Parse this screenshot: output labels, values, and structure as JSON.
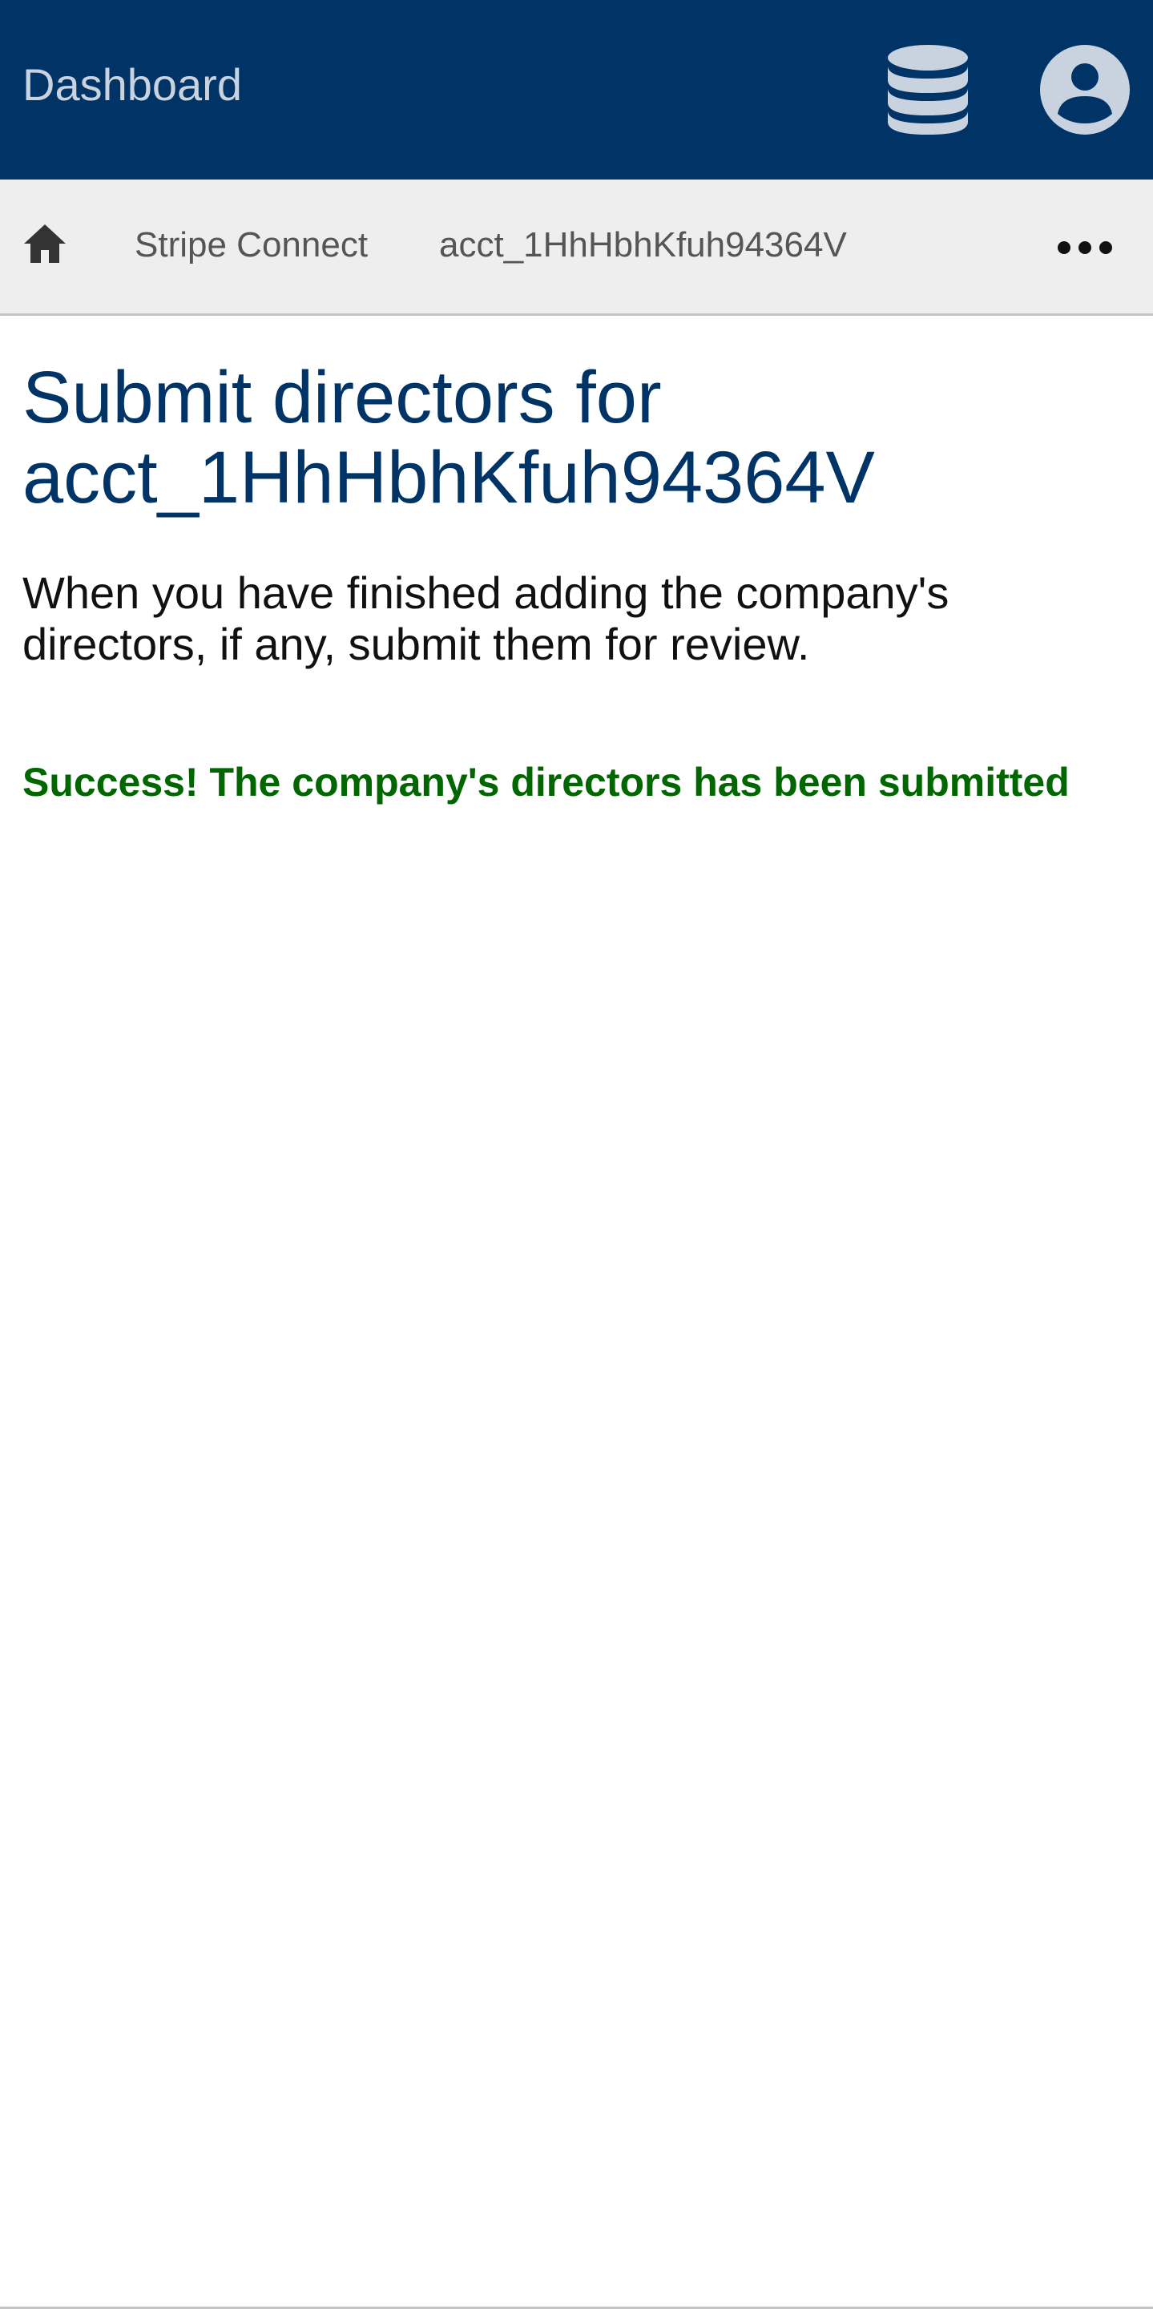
{
  "header": {
    "title": "Dashboard",
    "icons": [
      "database-icon",
      "account-circle-icon"
    ],
    "background_color": "#003366"
  },
  "breadcrumb": {
    "home_icon": "home-icon",
    "items": [
      {
        "label": "Stripe Connect"
      },
      {
        "label": "acct_1HhHbhKfuh94364V"
      }
    ],
    "more_icon": "more-horizontal-icon"
  },
  "main": {
    "title": "Submit directors for acct_1HhHbhKfuh94364V",
    "description": "When you have finished adding the company's directors, if any, submit them for review.",
    "success_message": "Success! The company's directors has been submitted",
    "colors": {
      "title": "#003366",
      "success": "#006600"
    }
  }
}
